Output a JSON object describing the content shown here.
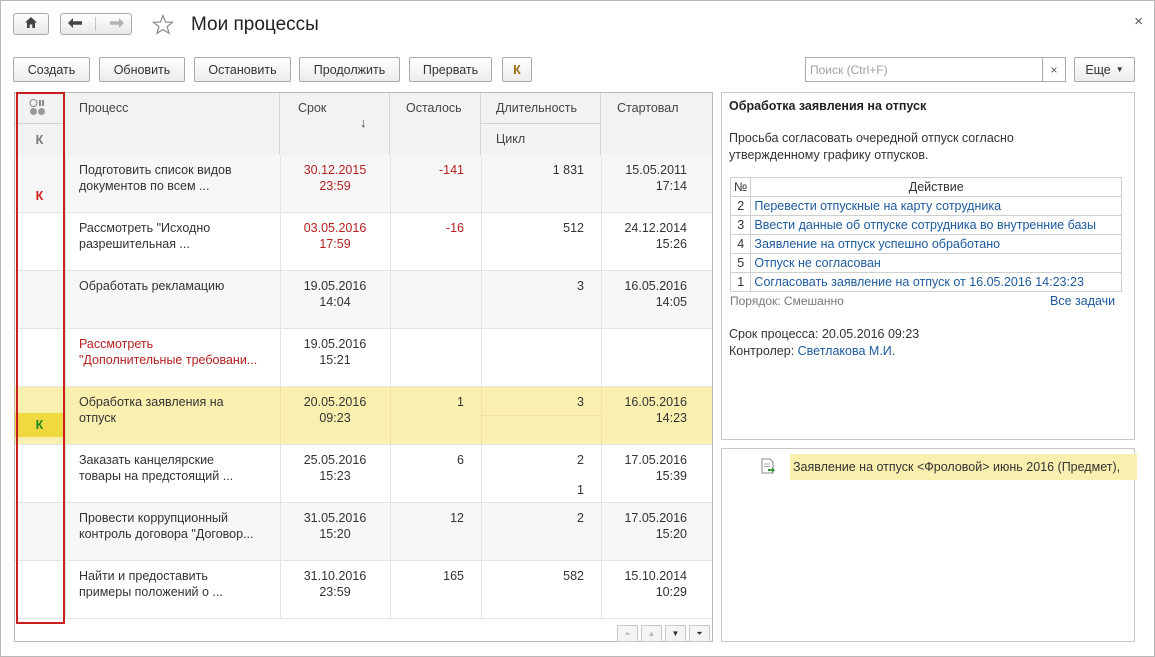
{
  "window": {
    "title": "Мои процессы",
    "close": "×"
  },
  "toolbar": {
    "create": "Создать",
    "refresh": "Обновить",
    "stop": "Остановить",
    "continue": "Продолжить",
    "abort": "Прервать",
    "k": "К",
    "search_placeholder": "Поиск (Ctrl+F)",
    "search_clear": "×",
    "more": "Еще"
  },
  "grid": {
    "headers": {
      "k": "К",
      "process": "Процесс",
      "deadline": "Срок",
      "sort_arrow": "↓",
      "remaining": "Осталось",
      "duration": "Длительность",
      "cycle": "Цикл",
      "started": "Стартовал"
    },
    "rows": [
      {
        "k": "К",
        "k_color": "#d02020",
        "process": [
          "Подготовить список видов",
          "документов по всем ..."
        ],
        "deadline": [
          "30.12.2015",
          "23:59"
        ],
        "deadline_red": true,
        "remaining": "-141",
        "duration": "1 831",
        "cycle": "",
        "started": [
          "15.05.2011",
          "17:14"
        ]
      },
      {
        "k": "",
        "process": [
          "Рассмотреть \"Исходно",
          "разрешительная ..."
        ],
        "deadline": [
          "03.05.2016",
          "17:59"
        ],
        "deadline_red": true,
        "remaining": "-16",
        "duration": "512",
        "cycle": "",
        "started": [
          "24.12.2014",
          "15:26"
        ]
      },
      {
        "k": "",
        "process": [
          "Обработать рекламацию",
          ""
        ],
        "deadline": [
          "19.05.2016",
          "14:04"
        ],
        "deadline_red": false,
        "remaining": "",
        "duration": "3",
        "cycle": "",
        "started": [
          "16.05.2016",
          "14:05"
        ]
      },
      {
        "k": "",
        "process": [
          "Рассмотреть",
          "\"Дополнительные требовани..."
        ],
        "process_red": true,
        "deadline": [
          "19.05.2016",
          "15:21"
        ],
        "deadline_red": false,
        "remaining": "",
        "duration": "",
        "cycle": "",
        "started": [
          "",
          ""
        ]
      },
      {
        "k": "К",
        "k_color": "#1f8a1f",
        "process": [
          "Обработка заявления на",
          "отпуск"
        ],
        "deadline": [
          "20.05.2016",
          "09:23"
        ],
        "deadline_red": false,
        "remaining": "1",
        "duration": "3",
        "cycle": "",
        "started": [
          "16.05.2016",
          "14:23"
        ],
        "selected": true
      },
      {
        "k": "",
        "process": [
          "Заказать канцелярские",
          "товары на предстоящий ..."
        ],
        "deadline": [
          "25.05.2016",
          "15:23"
        ],
        "deadline_red": false,
        "remaining": "6",
        "duration": "2",
        "cycle": "1",
        "started": [
          "17.05.2016",
          "15:39"
        ]
      },
      {
        "k": "",
        "process": [
          "Провести коррупционный",
          "контроль договора \"Договор..."
        ],
        "deadline": [
          "31.05.2016",
          "15:20"
        ],
        "deadline_red": false,
        "remaining": "12",
        "duration": "2",
        "cycle": "",
        "started": [
          "17.05.2016",
          "15:20"
        ]
      },
      {
        "k": "",
        "process": [
          "Найти и предоставить",
          "примеры положений о ..."
        ],
        "deadline": [
          "31.10.2016",
          "23:59"
        ],
        "deadline_red": false,
        "remaining": "165",
        "duration": "582",
        "cycle": "",
        "started": [
          "15.10.2014",
          "10:29"
        ]
      }
    ]
  },
  "scroll_buttons": [
    "⏶",
    "▲",
    "▼",
    "⏷"
  ],
  "detail": {
    "title": "Обработка заявления на отпуск",
    "description": [
      "Просьба согласовать очередной отпуск согласно",
      "утвержденному графику отпусков."
    ],
    "actions_header": {
      "num": "№",
      "action": "Действие"
    },
    "actions": [
      {
        "num": "2",
        "text": "Перевести отпускные на карту сотрудника"
      },
      {
        "num": "3",
        "text": "Ввести данные об отпуске сотрудника во внутренние базы"
      },
      {
        "num": "4",
        "text": "Заявление на отпуск успешно обработано"
      },
      {
        "num": "5",
        "text": "Отпуск не согласован"
      },
      {
        "num": "1",
        "text": "Согласовать заявление на отпуск от 16.05.2016 14:23:23"
      }
    ],
    "order_label": "Порядок: Смешанно",
    "all_tasks": "Все задачи",
    "deadline_label": "Срок процесса:",
    "deadline_value": "20.05.2016 09:23",
    "controller_label": "Контролер:",
    "controller_value": "Светлакова М.И."
  },
  "attachments": {
    "item": "Заявление на отпуск <Фроловой> июнь 2016 (Предмет),"
  }
}
